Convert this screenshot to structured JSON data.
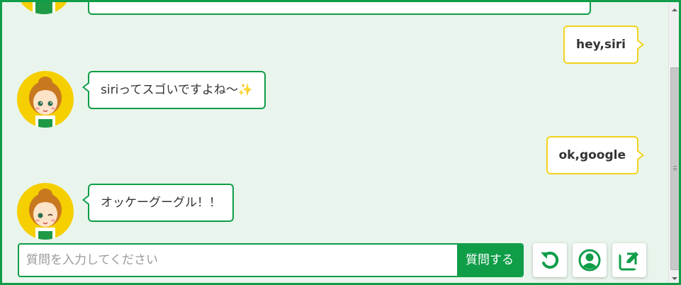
{
  "chat": {
    "messages": [
      {
        "sender": "user",
        "text": "hey,siri"
      },
      {
        "sender": "operator",
        "text": "siriってスゴいですよね〜✨"
      },
      {
        "sender": "user",
        "text": "ok,google"
      },
      {
        "sender": "operator",
        "text": "オッケーグーグル！！"
      }
    ]
  },
  "input": {
    "placeholder": "質問を入力してください",
    "value": "",
    "send_label": "質問する"
  },
  "toolbar": {
    "icons": [
      "refresh-icon",
      "user-circle-icon",
      "edit-icon"
    ]
  },
  "colors": {
    "brand_green": "#0f9d48",
    "user_bubble_border": "#f2d21a",
    "background": "#e9f5ec",
    "avatar_bg": "#f5cf00"
  }
}
